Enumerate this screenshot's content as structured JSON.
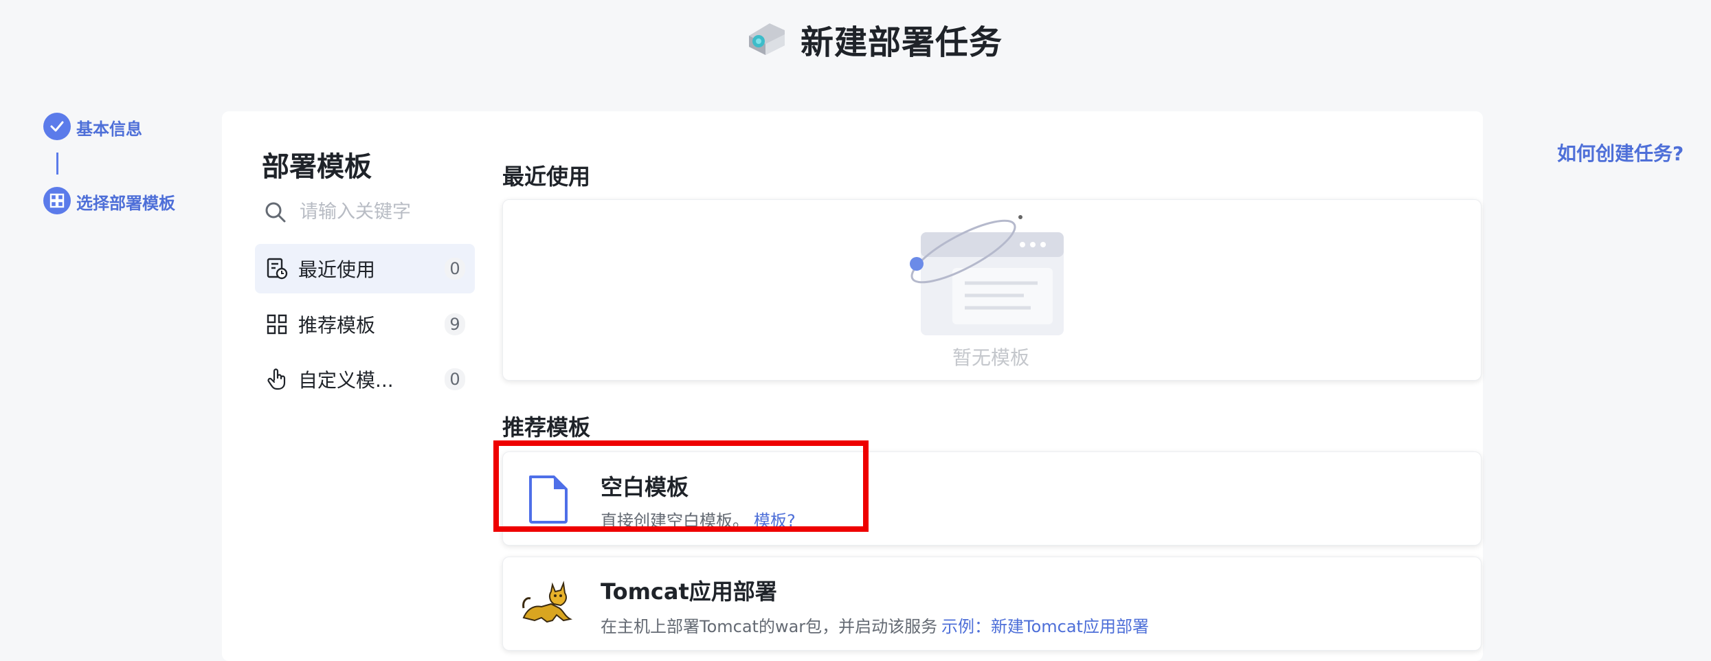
{
  "header": {
    "title": "新建部署任务",
    "logo_icon": "cloud-deploy-icon"
  },
  "steps": [
    {
      "label": "基本信息",
      "icon": "check-icon",
      "state": "done"
    },
    {
      "label": "选择部署模板",
      "icon": "template-icon",
      "state": "current"
    }
  ],
  "help_link": "如何创建任务?",
  "sidebar": {
    "title": "部署模板",
    "search": {
      "placeholder": "请输入关键字",
      "value": ""
    },
    "items": [
      {
        "label": "最近使用",
        "count": "0",
        "icon": "recent-list-icon",
        "active": true
      },
      {
        "label": "推荐模板",
        "count": "9",
        "icon": "grid-icon",
        "active": false
      },
      {
        "label": "自定义模...",
        "count": "0",
        "icon": "hand-pointer-icon",
        "active": false
      }
    ]
  },
  "recent": {
    "title": "最近使用",
    "empty_text": "暂无模板"
  },
  "recommended": {
    "title": "推荐模板",
    "templates": [
      {
        "name": "空白模板",
        "desc": "直接创建空白模板。",
        "link": "模板?",
        "icon": "blank-file-icon"
      },
      {
        "name": "Tomcat应用部署",
        "desc": "在主机上部署Tomcat的war包，并启动该服务",
        "link": "示例：新建Tomcat应用部署",
        "icon": "tomcat-icon"
      }
    ]
  },
  "colors": {
    "accent": "#5b7bea",
    "link": "#4e6fd8",
    "highlight": "#ee0000",
    "background": "#f6f7f9"
  }
}
